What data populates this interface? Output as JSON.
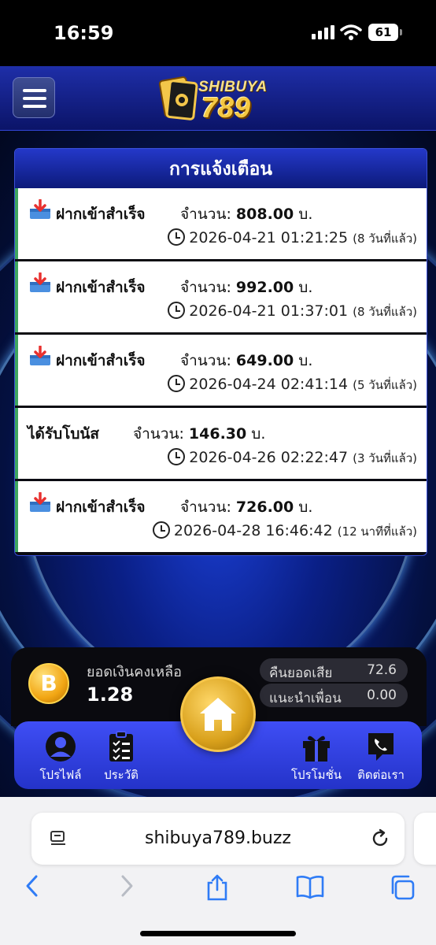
{
  "status_bar": {
    "time": "16:59",
    "battery": "61"
  },
  "header": {
    "logo_top": "SHIBUYA",
    "logo_num": "789"
  },
  "panel": {
    "title": "การแจ้งเตือน",
    "notifications": [
      {
        "type": "deposit",
        "title": "ฝากเข้าสำเร็จ",
        "amount_label": "จำนวน:",
        "amount": "808.00",
        "unit": "บ.",
        "datetime": "2026-04-21 01:21:25",
        "ago": "(8 วันที่แล้ว)"
      },
      {
        "type": "deposit",
        "title": "ฝากเข้าสำเร็จ",
        "amount_label": "จำนวน:",
        "amount": "992.00",
        "unit": "บ.",
        "datetime": "2026-04-21 01:37:01",
        "ago": "(8 วันที่แล้ว)"
      },
      {
        "type": "deposit",
        "title": "ฝากเข้าสำเร็จ",
        "amount_label": "จำนวน:",
        "amount": "649.00",
        "unit": "บ.",
        "datetime": "2026-04-24 02:41:14",
        "ago": "(5 วันที่แล้ว)"
      },
      {
        "type": "bonus",
        "title": "ได้รับโบนัส",
        "amount_label": "จำนวน:",
        "amount": "146.30",
        "unit": "บ.",
        "datetime": "2026-04-26 02:22:47",
        "ago": "(3 วันที่แล้ว)"
      },
      {
        "type": "deposit",
        "title": "ฝากเข้าสำเร็จ",
        "amount_label": "จำนวน:",
        "amount": "726.00",
        "unit": "บ.",
        "datetime": "2026-04-28 16:46:42",
        "ago": "(12 นาทีที่แล้ว)"
      }
    ]
  },
  "balance": {
    "label": "ยอดเงินคงเหลือ",
    "value": "1.28",
    "coin_symbol": "B",
    "cashback": {
      "label": "คืนยอดเสีย",
      "value": "72.6"
    },
    "referral": {
      "label": "แนะนำเพื่อน",
      "value": "0.00"
    }
  },
  "nav": {
    "profile": "โปรไฟล์",
    "history": "ประวัติ",
    "promotion": "โปรโมชั่น",
    "contact": "ติดต่อเรา"
  },
  "safari": {
    "url": "shibuya789.buzz"
  },
  "colors": {
    "accent_blue": "#2433c9",
    "deposit_border": "#3fa55f",
    "gold": "#f5c842"
  }
}
